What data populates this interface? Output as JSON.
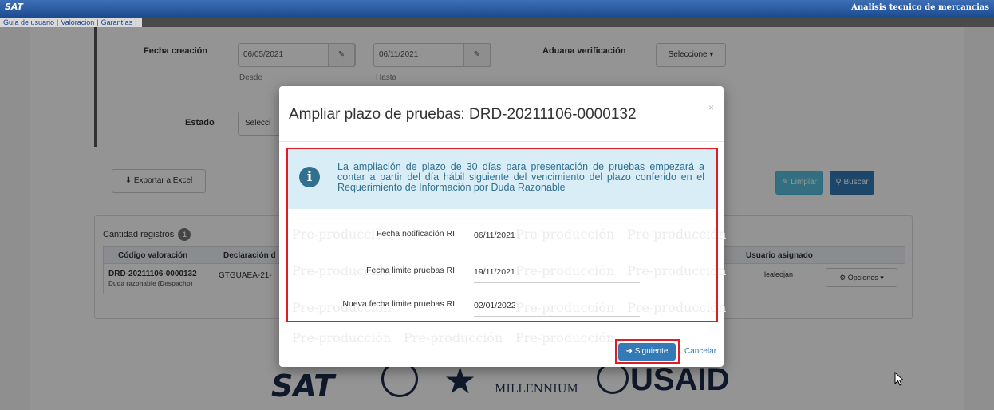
{
  "topbar": {
    "logo": "SAT",
    "app_title": "Analisis tecnico de mercancias"
  },
  "menu": {
    "items": [
      "Guía de usuario",
      "Valoracion",
      "Garantías"
    ]
  },
  "filters": {
    "fecha_creacion_label": "Fecha creación",
    "fecha_desde": "06/05/2021",
    "fecha_hasta": "06/11/2021",
    "desde_label": "Desde",
    "hasta_label": "Hasta",
    "aduana_label": "Aduana verificación",
    "aduana_select": "Seleccione ▾",
    "estado_label": "Estado",
    "estado_select": "Selecci"
  },
  "actions": {
    "exportar": "Exportar a Excel",
    "limpiar": "Limpiar",
    "buscar": "Buscar"
  },
  "results": {
    "cantidad_label": "Cantidad registros",
    "count": "1",
    "headers": [
      "Código valoración",
      "Declaración d",
      "Usuario asignado"
    ],
    "row": {
      "codigo": "DRD-20211106-0000132",
      "codigo_sub": "Duda razonable (Despacho)",
      "declaracion": "GTGUAEA-21-",
      "usuario": "lealeojan",
      "opciones": "Opciones ▾"
    }
  },
  "footer_logos": {
    "sat": "SAT",
    "millennium": "MILLENNIUM",
    "usaid": "USAID"
  },
  "modal": {
    "title": "Ampliar plazo de pruebas: DRD-20211106-0000132",
    "close": "×",
    "alert_text": "La ampliación de plazo de 30 días para presentación de pruebas empezará a contar a partir del día hábil siguiente del vencimiento del plazo conferido en el Requerimiento de Información por Duda Razonable",
    "watermark": "Pre-producción",
    "fields": [
      {
        "label": "Fecha notificación RI",
        "value": "06/11/2021"
      },
      {
        "label": "Fecha limite pruebas RI",
        "value": "19/11/2021"
      },
      {
        "label": "Nueva fecha limite pruebas RI",
        "value": "02/01/2022"
      }
    ],
    "next_button": "Siguiente",
    "cancel_button": "Cancelar"
  }
}
